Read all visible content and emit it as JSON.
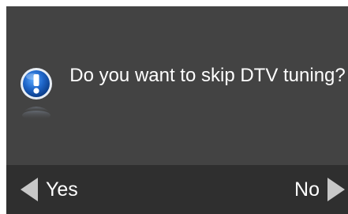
{
  "dialog": {
    "message": "Do you want to skip DTV tuning?",
    "icon": "info-icon",
    "background_color": "#444444",
    "footer_color": "#2f2f2f"
  },
  "buttons": {
    "yes_label": "Yes",
    "no_label": "No",
    "left_icon": "arrow-left-icon",
    "right_icon": "arrow-right-icon"
  }
}
